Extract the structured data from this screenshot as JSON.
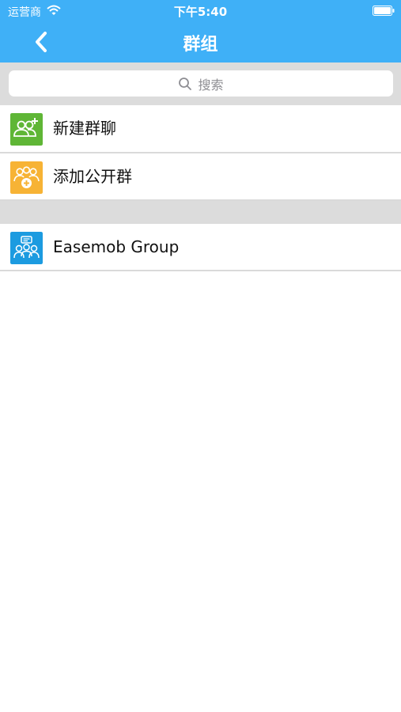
{
  "status_bar": {
    "carrier": "运营商",
    "time": "下午5:40"
  },
  "nav": {
    "title": "群组",
    "back_icon": "chevron-left-icon"
  },
  "search": {
    "placeholder": "搜索",
    "icon": "search-icon"
  },
  "actions": [
    {
      "label": "新建群聊",
      "icon": "add-group-icon",
      "color": "#5fb636"
    },
    {
      "label": "添加公开群",
      "icon": "public-group-icon",
      "color": "#f7b335"
    }
  ],
  "groups": [
    {
      "label": "Easemob Group",
      "icon": "group-chat-icon",
      "color": "#1c9be0"
    }
  ],
  "colors": {
    "header": "#3fb0f7",
    "section_background": "#dcdcdc"
  }
}
